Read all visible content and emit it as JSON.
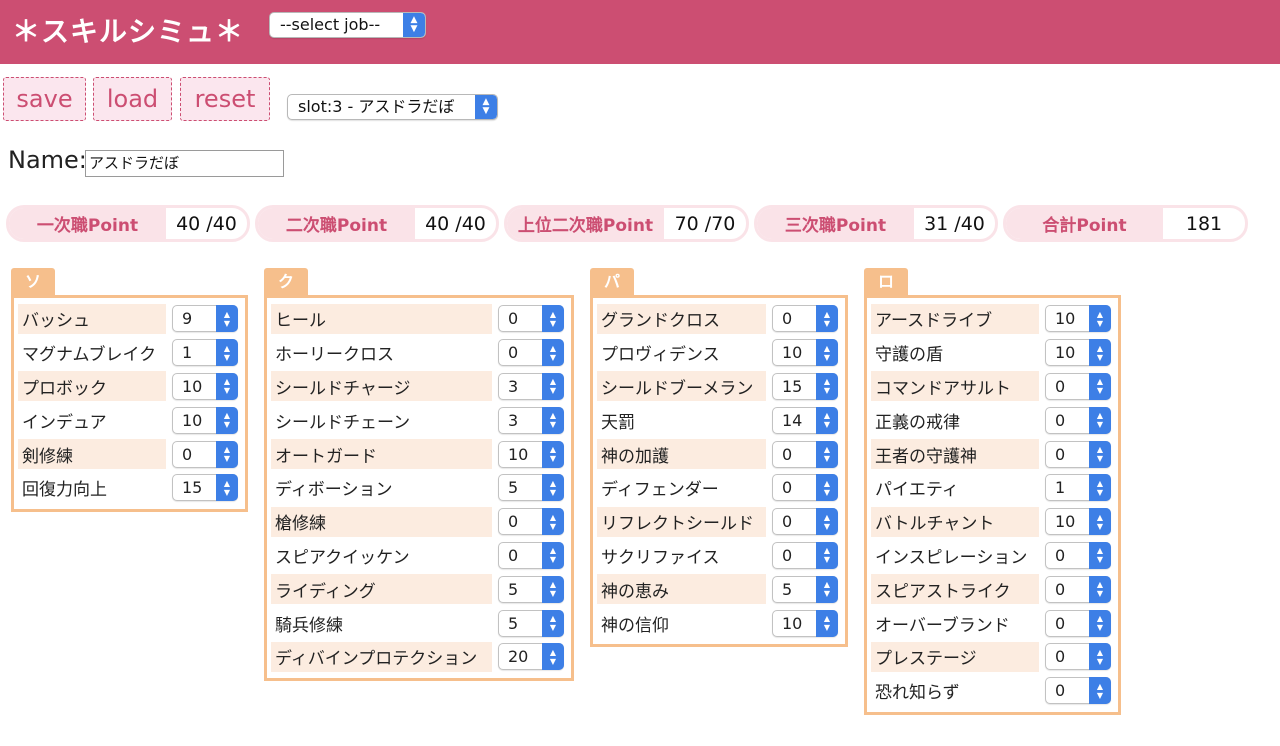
{
  "header": {
    "title": "＊スキルシミュ＊",
    "job_select": "--select job--"
  },
  "toolbar": {
    "save": "save",
    "load": "load",
    "reset": "reset",
    "slot_select": "slot:3 - アスドラだぼ"
  },
  "name": {
    "label": "Name:",
    "value": "アスドラだぼ"
  },
  "points": [
    {
      "label": "一次職Point",
      "value": "40 /40"
    },
    {
      "label": "二次職Point",
      "value": "40 /40"
    },
    {
      "label": "上位二次職Point",
      "value": "70 /70"
    },
    {
      "label": "三次職Point",
      "value": "31 /40"
    },
    {
      "label": "合計Point",
      "value": "181"
    }
  ],
  "groups": [
    {
      "title": "ソードマン",
      "skills": [
        {
          "name": "バッシュ",
          "level": "9"
        },
        {
          "name": "マグナムブレイク",
          "level": "1"
        },
        {
          "name": "プロボック",
          "level": "10"
        },
        {
          "name": "インデュア",
          "level": "10"
        },
        {
          "name": "剣修練",
          "level": "0"
        },
        {
          "name": "回復力向上",
          "level": "15"
        }
      ]
    },
    {
      "title": "クルセイダー",
      "skills": [
        {
          "name": "ヒール",
          "level": "0"
        },
        {
          "name": "ホーリークロス",
          "level": "0"
        },
        {
          "name": "シールドチャージ",
          "level": "3"
        },
        {
          "name": "シールドチェーン",
          "level": "3"
        },
        {
          "name": "オートガード",
          "level": "10"
        },
        {
          "name": "ディボーション",
          "level": "5"
        },
        {
          "name": "槍修練",
          "level": "0"
        },
        {
          "name": "スピアクイッケン",
          "level": "0"
        },
        {
          "name": "ライディング",
          "level": "5"
        },
        {
          "name": "騎兵修練",
          "level": "5"
        },
        {
          "name": "ディバインプロテクション",
          "level": "20"
        }
      ]
    },
    {
      "title": "パラディン",
      "skills": [
        {
          "name": "グランドクロス",
          "level": "0"
        },
        {
          "name": "プロヴィデンス",
          "level": "10"
        },
        {
          "name": "シールドブーメラン",
          "level": "15"
        },
        {
          "name": "天罰",
          "level": "14"
        },
        {
          "name": "神の加護",
          "level": "0"
        },
        {
          "name": "ディフェンダー",
          "level": "0"
        },
        {
          "name": "リフレクトシールド",
          "level": "0"
        },
        {
          "name": "サクリファイス",
          "level": "0"
        },
        {
          "name": "神の恵み",
          "level": "5"
        },
        {
          "name": "神の信仰",
          "level": "10"
        }
      ]
    },
    {
      "title": "ロイヤルガード",
      "skills": [
        {
          "name": "アースドライブ",
          "level": "10"
        },
        {
          "name": "守護の盾",
          "level": "10"
        },
        {
          "name": "コマンドアサルト",
          "level": "0"
        },
        {
          "name": "正義の戒律",
          "level": "0"
        },
        {
          "name": "王者の守護神",
          "level": "0"
        },
        {
          "name": "パイエティ",
          "level": "1"
        },
        {
          "name": "バトルチャント",
          "level": "10"
        },
        {
          "name": "インスピレーション",
          "level": "0"
        },
        {
          "name": "スピアストライク",
          "level": "0"
        },
        {
          "name": "オーバーブランド",
          "level": "0"
        },
        {
          "name": "プレステージ",
          "level": "0"
        },
        {
          "name": "恐れ知らず",
          "level": "0"
        }
      ]
    }
  ],
  "icons": {
    "select_arrow": "chevron-up-down-icon"
  },
  "colors": {
    "header": "#cc4e72",
    "group_border": "#f6bf8c",
    "row_shade": "#fcece0",
    "point_label_bg": "#fae3e8",
    "select_arrow": "#3d7fe6"
  }
}
